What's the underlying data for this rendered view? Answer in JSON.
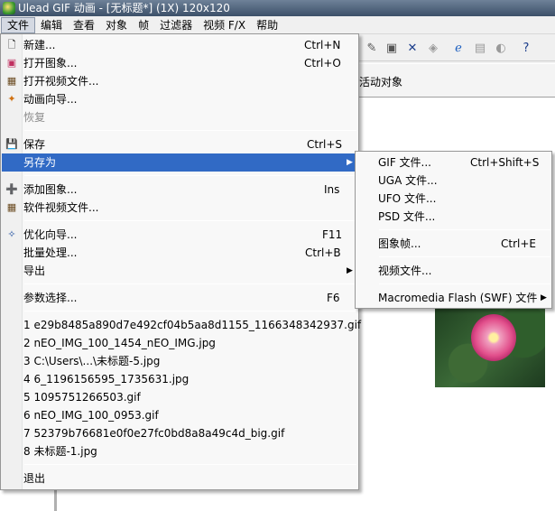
{
  "window": {
    "title": "Ulead GIF 动画 - [无标题*] (1X) 120x120"
  },
  "menubar": {
    "items": [
      "文件",
      "编辑",
      "查看",
      "对象",
      "帧",
      "过滤器",
      "视频 F/X",
      "帮助"
    ]
  },
  "toolbar": {
    "object_bar_label": "活动对象"
  },
  "file_menu": {
    "items": [
      {
        "label": "新建...",
        "shortcut": "Ctrl+N",
        "icon": "new-file-icon"
      },
      {
        "label": "打开图象...",
        "shortcut": "Ctrl+O",
        "icon": "open-image-icon"
      },
      {
        "label": "打开视频文件...",
        "shortcut": "",
        "icon": "open-video-icon"
      },
      {
        "label": "动画向导...",
        "shortcut": "",
        "icon": "wizard-icon"
      },
      {
        "label": "恢复",
        "shortcut": "",
        "icon": ""
      },
      {
        "label": "保存",
        "shortcut": "Ctrl+S",
        "icon": "save-icon"
      },
      {
        "label": "另存为",
        "shortcut": "",
        "icon": ""
      },
      {
        "label": "添加图象...",
        "shortcut": "Ins",
        "icon": "add-image-icon"
      },
      {
        "label": "软件视频文件...",
        "shortcut": "",
        "icon": "video-file-icon"
      },
      {
        "label": "优化向导...",
        "shortcut": "F11",
        "icon": "optimize-icon"
      },
      {
        "label": "批量处理...",
        "shortcut": "Ctrl+B",
        "icon": ""
      },
      {
        "label": "导出",
        "shortcut": "",
        "icon": ""
      },
      {
        "label": "参数选择...",
        "shortcut": "F6",
        "icon": ""
      }
    ],
    "recent": [
      "1 e29b8485a890d7e492cf04b5aa8d1155_1166348342937.gif",
      "2 nEO_IMG_100_1454_nEO_IMG.jpg",
      "3 C:\\Users\\...\\未标题-5.jpg",
      "4 6_1196156595_1735631.jpg",
      "5 1095751266503.gif",
      "6 nEO_IMG_100_0953.gif",
      "7 52379b76681e0f0e27fc0bd8a8a49c4d_big.gif",
      "8 未标题-1.jpg"
    ],
    "exit": "退出"
  },
  "saveas_menu": {
    "items": [
      {
        "label": "GIF 文件...",
        "shortcut": "Ctrl+Shift+S"
      },
      {
        "label": "UGA 文件...",
        "shortcut": ""
      },
      {
        "label": "UFO 文件...",
        "shortcut": ""
      },
      {
        "label": "PSD 文件...",
        "shortcut": ""
      },
      {
        "label": "图象帧...",
        "shortcut": "Ctrl+E"
      },
      {
        "label": "视频文件...",
        "shortcut": ""
      },
      {
        "label": "Macromedia Flash (SWF) 文件",
        "shortcut": ""
      }
    ]
  },
  "colors": {
    "highlight": "#316ac5",
    "menu_bg": "#f8f8f8",
    "disabled": "#8d8d8d"
  }
}
